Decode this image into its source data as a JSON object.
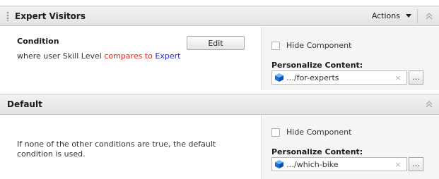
{
  "sections": [
    {
      "title": "Expert Visitors",
      "actions_label": "Actions",
      "condition": {
        "title": "Condition",
        "prefix": "where user Skill Level",
        "operator": "compares to",
        "value": "Expert"
      },
      "edit_label": "Edit",
      "hide_component_label": "Hide Component",
      "personalize_label": "Personalize Content:",
      "content_value": "…/for-experts"
    },
    {
      "title": "Default",
      "description": "If none of the other conditions are true, the default condition is used.",
      "hide_component_label": "Hide Component",
      "personalize_label": "Personalize Content:",
      "content_value": "…/which-bike"
    }
  ],
  "icons": {
    "collapse": "double-chevron-up-icon",
    "item": "blue-cube-icon",
    "clear": "clear-x-icon",
    "browse": "ellipsis"
  },
  "browse_label": "...",
  "clear_glyph": "×",
  "colors": {
    "operator": "#e0201c",
    "value": "#2323d9"
  }
}
